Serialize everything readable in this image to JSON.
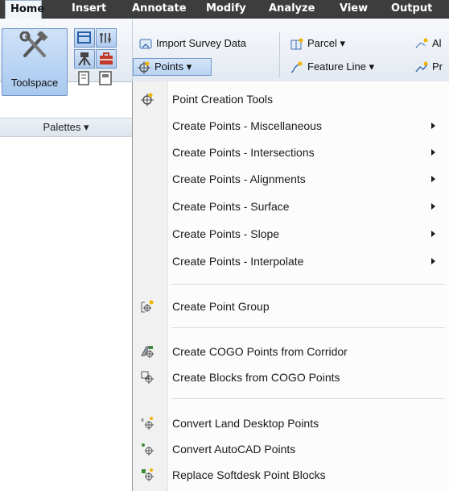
{
  "tabs": [
    {
      "label": "Home",
      "active": true
    },
    {
      "label": "Insert",
      "active": false
    },
    {
      "label": "Annotate",
      "active": false
    },
    {
      "label": "Modify",
      "active": false
    },
    {
      "label": "Analyze",
      "active": false
    },
    {
      "label": "View",
      "active": false
    },
    {
      "label": "Output",
      "active": false
    }
  ],
  "ribbon": {
    "toolspace_label": "Toolspace",
    "palettes_label": "Palettes ▾",
    "import_survey": "Import Survey Data",
    "parcel": "Parcel ▾",
    "points": "Points ▾",
    "feature_line": "Feature Line ▾",
    "cut_right_top": "Al",
    "cut_right_bottom": "Pr"
  },
  "menu": {
    "items": [
      {
        "label": "Point Creation Tools",
        "icon": "point-creation-tools-icon"
      },
      {
        "label": "Create Points - Miscellaneous",
        "submenu": true
      },
      {
        "label": "Create Points - Intersections",
        "submenu": true
      },
      {
        "label": "Create Points - Alignments",
        "submenu": true
      },
      {
        "label": "Create Points - Surface",
        "submenu": true
      },
      {
        "label": "Create Points - Slope",
        "submenu": true
      },
      {
        "label": "Create Points - Interpolate",
        "submenu": true
      },
      {
        "label": "Create Point Group",
        "icon": "point-group-icon"
      },
      {
        "label": "Create COGO Points from Corridor",
        "icon": "corridor-points-icon"
      },
      {
        "label": "Create Blocks from COGO Points",
        "icon": "blocks-from-points-icon"
      },
      {
        "label": "Convert Land Desktop Points",
        "icon": "convert-ld-points-icon"
      },
      {
        "label": "Convert AutoCAD Points",
        "icon": "convert-autocad-points-icon"
      },
      {
        "label": "Replace Softdesk Point Blocks",
        "icon": "replace-softdesk-icon"
      }
    ]
  },
  "colors": {
    "tab_bar": "#3d3d3d",
    "selected_blue": "#b7d2f2",
    "menu_bg": "#fcfcfc"
  }
}
